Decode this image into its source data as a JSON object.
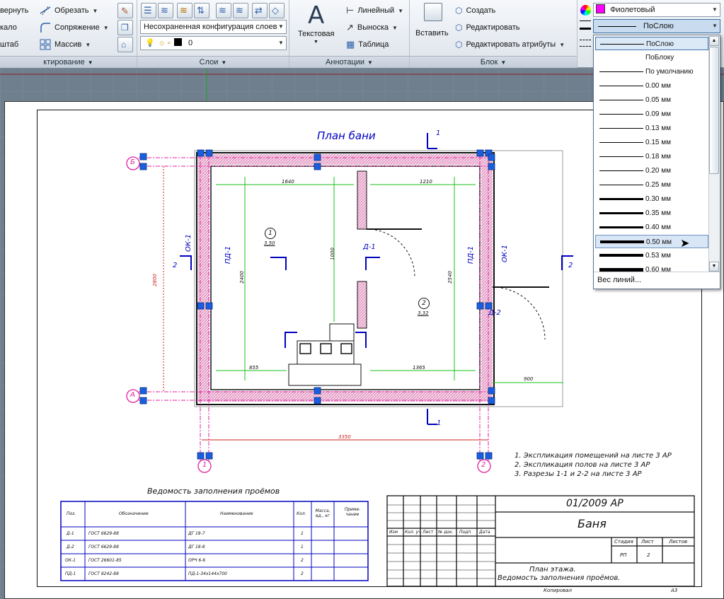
{
  "ribbon": {
    "edit": {
      "row1_label": "вернуть",
      "row2_label": "кало",
      "row3_label": "штаб",
      "trim_label": "Обрезать",
      "fillet_label": "Сопряжение",
      "array_label": "Массив",
      "panel_title": "ктирование"
    },
    "layers": {
      "layer_state": "Несохраненная конфигурация слоев",
      "current_layer": "0",
      "panel_title": "Слои"
    },
    "annotation": {
      "text_label": "Текстовая",
      "linear_label": "Линейный",
      "leader_label": "Выноска",
      "table_label": "Таблица",
      "panel_title": "Аннотации"
    },
    "block": {
      "insert_label": "Вставить",
      "create_label": "Создать",
      "edit_label": "Редактировать",
      "edit_attr_label": "Редактировать атрибуты",
      "panel_title": "Блок"
    },
    "properties": {
      "color_label": "Фиолетовый",
      "color_hex": "#ff00ff",
      "lineweight_value": "ПоСлою"
    }
  },
  "lineweight_dropdown": {
    "items": [
      {
        "label": "ПоСлою",
        "weight": 1,
        "state": "selected"
      },
      {
        "label": "ПоБлоку",
        "weight": 0,
        "state": ""
      },
      {
        "label": "По умолчанию",
        "weight": 1,
        "state": ""
      },
      {
        "label": "0.00 мм",
        "weight": 1,
        "state": ""
      },
      {
        "label": "0.05 мм",
        "weight": 1,
        "state": ""
      },
      {
        "label": "0.09 мм",
        "weight": 1,
        "state": ""
      },
      {
        "label": "0.13 мм",
        "weight": 1,
        "state": ""
      },
      {
        "label": "0.15 мм",
        "weight": 1,
        "state": ""
      },
      {
        "label": "0.18 мм",
        "weight": 1,
        "state": ""
      },
      {
        "label": "0.20 мм",
        "weight": 1,
        "state": ""
      },
      {
        "label": "0.25 мм",
        "weight": 1,
        "state": ""
      },
      {
        "label": "0.30 мм",
        "weight": 3,
        "state": ""
      },
      {
        "label": "0.35 мм",
        "weight": 3,
        "state": ""
      },
      {
        "label": "0.40 мм",
        "weight": 3,
        "state": ""
      },
      {
        "label": "0.50 мм",
        "weight": 4,
        "state": "hover"
      },
      {
        "label": "0.53 мм",
        "weight": 4,
        "state": ""
      },
      {
        "label": "0.60 мм",
        "weight": 5,
        "state": ""
      }
    ],
    "footer": "Вес линий..."
  },
  "drawing": {
    "plan_title": "План бани",
    "dims": {
      "top_left": "1640",
      "top_right": "1210",
      "mid_vertical": "1000",
      "left_height": "2400",
      "right_height": "2540",
      "outer_height": "2800",
      "bottom_left": "855",
      "bottom_right": "1365",
      "overall": "3350",
      "porch": "900"
    },
    "labels": {
      "room1": "1",
      "room1_area": "3,50",
      "room2": "2",
      "room2_area": "3,32",
      "door1": "Д-1",
      "door2": "Д-2",
      "window1": "ОК-1",
      "window2": "ОК-1",
      "pd1": "ПД-1",
      "pd2": "ПД-1",
      "axis_b": "Б",
      "axis_a": "А",
      "axis_1": "1",
      "axis_2": "2",
      "section1_top": "1",
      "section1_bottom": "1",
      "section2_left": "2",
      "section2_right": "2"
    },
    "notes": [
      "1. Экспликация помещений на листе 3 АР",
      "2. Экспликация полов на листе 3 АР",
      "3. Разрезы 1-1 и 2-2 на листе 3 АР"
    ],
    "schedule": {
      "title": "Ведомость заполнения проёмов",
      "headers": [
        "Поз.",
        "Обозначение",
        "Наименование",
        "Кол.",
        "Масса, ед., кг",
        "Приме- чание"
      ],
      "rows": [
        [
          "Д-1",
          "ГОСТ 6629-88",
          "ДГ 18-7",
          "1",
          "",
          ""
        ],
        [
          "Д-2",
          "ГОСТ 6629-88",
          "ДГ 18-8",
          "1",
          "",
          ""
        ],
        [
          "ОК-1",
          "ГОСТ 26601-85",
          "ОРЧ 6-6",
          "2",
          "",
          ""
        ],
        [
          "ПД-1",
          "ГОСТ 8242-88",
          "ПД-1-34х144х700",
          "2",
          "",
          ""
        ]
      ]
    },
    "title_block": {
      "code": "01/2009 АР",
      "name": "Баня",
      "cols": [
        "Изм",
        "Кол. уч",
        "Лист",
        "№ док.",
        "Подп",
        "Дата"
      ],
      "stage_label": "Стадия",
      "sheet_label": "Лист",
      "sheets_label": "Листов",
      "stage": "РП",
      "sheet": "2",
      "sheet_title_1": "План этажа.",
      "sheet_title_2": "Ведомость заполнения проёмов.",
      "copied": "Копировал",
      "format": "А3"
    }
  }
}
